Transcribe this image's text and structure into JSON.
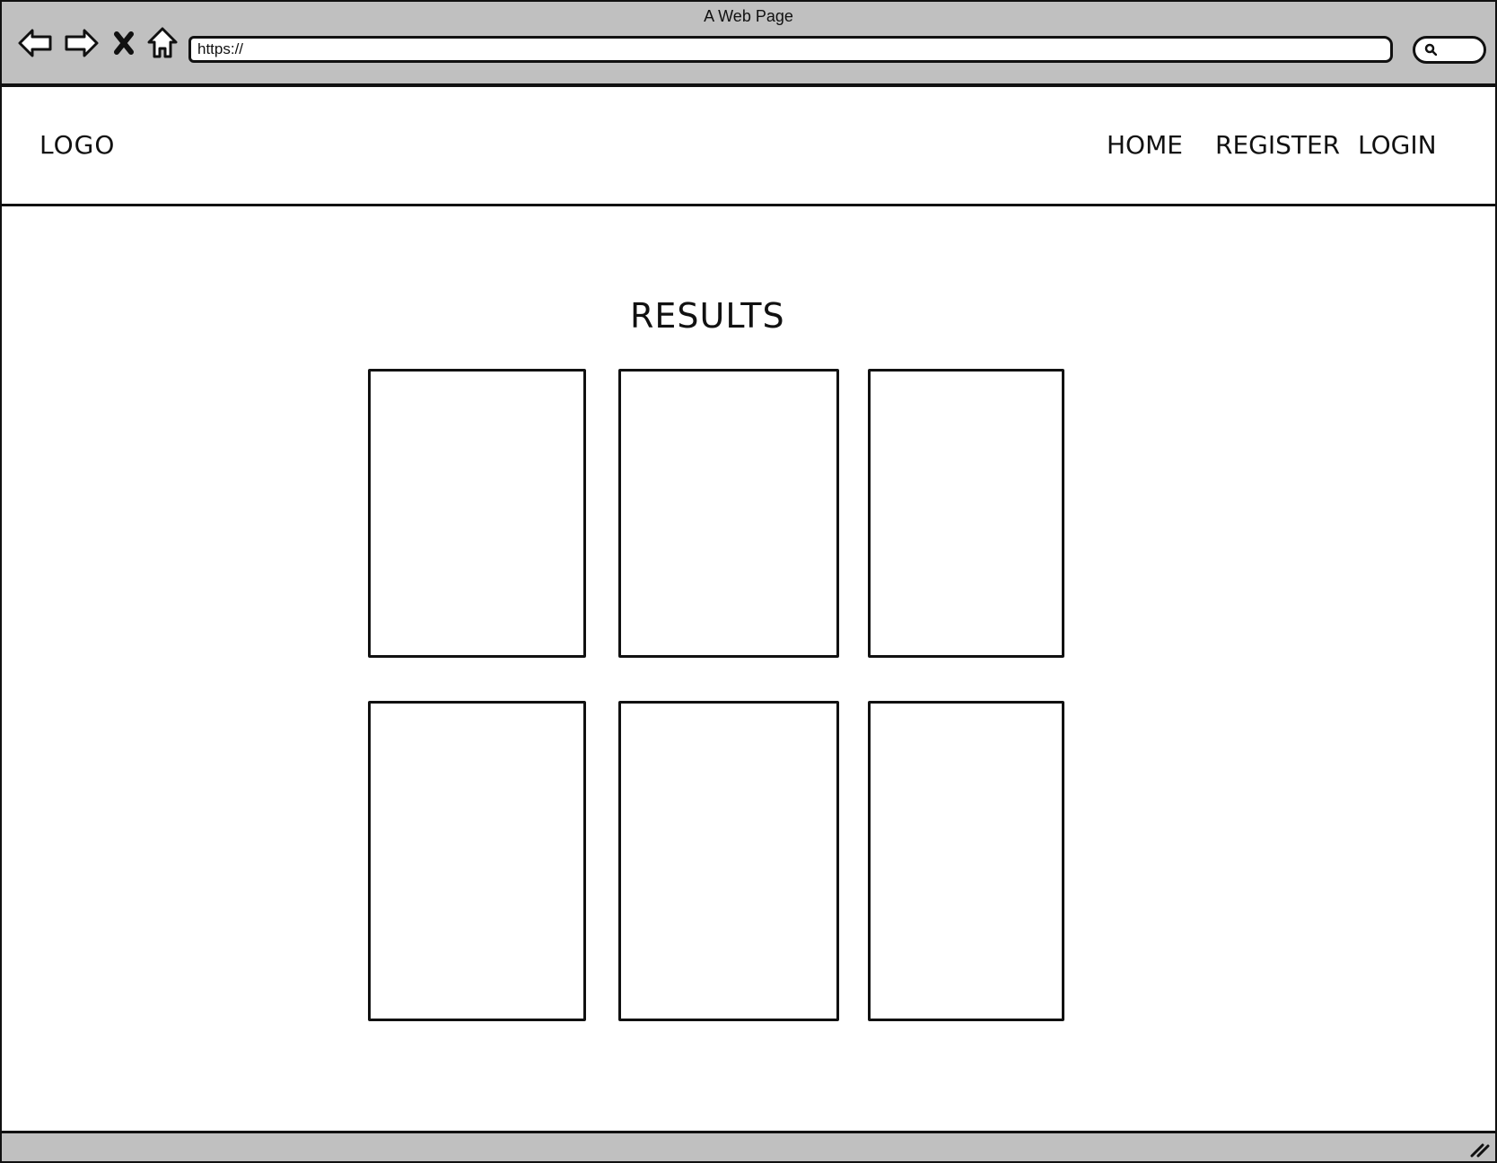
{
  "window": {
    "title": "A Web Page"
  },
  "browser": {
    "url": "https://",
    "icons": [
      "back-arrow-icon",
      "forward-arrow-icon",
      "close-icon",
      "home-icon",
      "search-icon"
    ]
  },
  "header": {
    "logo": "LOGO",
    "nav": {
      "home": "HOME",
      "register": "REGISTER",
      "login": "LOGIN"
    }
  },
  "main": {
    "title": "RESULTS",
    "cards": [
      {},
      {},
      {},
      {},
      {},
      {}
    ]
  },
  "colors": {
    "chrome": "#c0c0c0",
    "stroke": "#111111",
    "background": "#ffffff"
  }
}
